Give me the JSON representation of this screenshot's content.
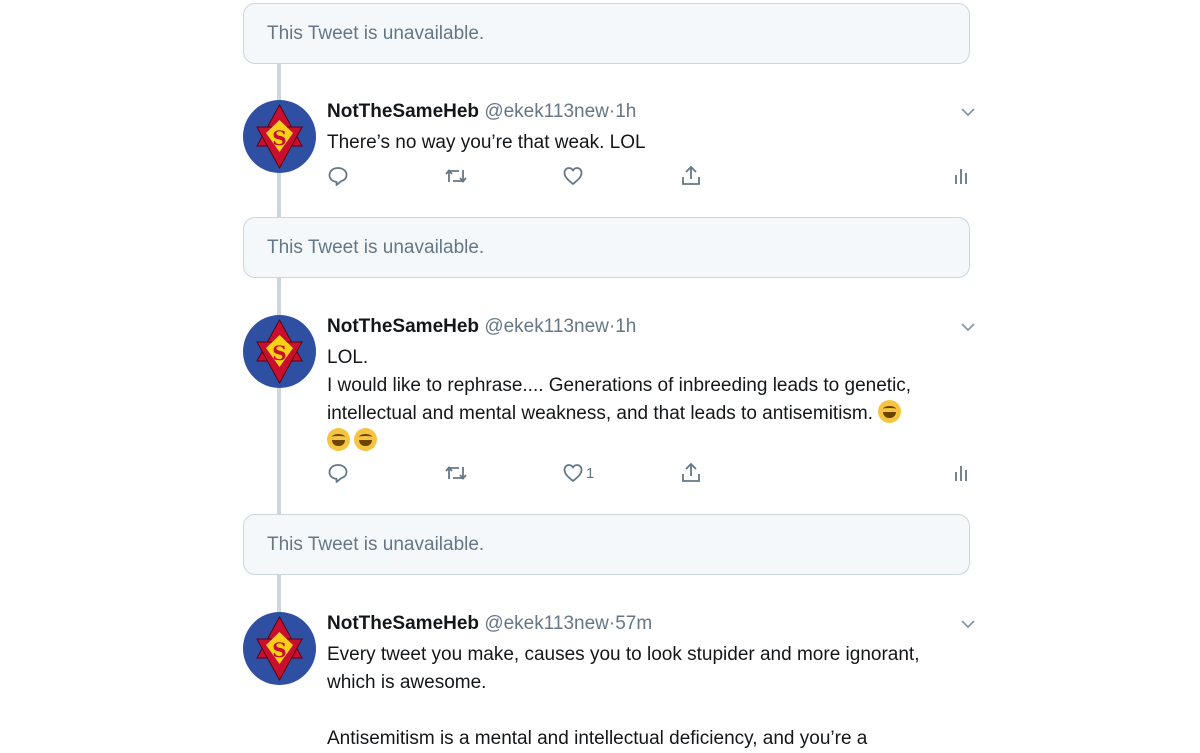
{
  "unavailable_text": "This Tweet is unavailable.",
  "tweets": [
    {
      "name": "NotTheSameHeb",
      "handle": "@ekek113new",
      "separator": "·",
      "time": "1h",
      "text": [
        "There’s no way you’re that weak. LOL"
      ],
      "likes": ""
    },
    {
      "name": "NotTheSameHeb",
      "handle": "@ekek113new",
      "separator": "·",
      "time": "1h",
      "text": [
        "LOL.",
        "I would like to rephrase.... Generations of inbreeding leads to genetic,",
        "intellectual and mental weakness, and that leads to antisemitism."
      ],
      "likes": "1"
    },
    {
      "name": "NotTheSameHeb",
      "handle": "@ekek113new",
      "separator": "·",
      "time": "57m",
      "text": [
        "Every tweet you make, causes you to look stupider and more ignorant,",
        "which is awesome.",
        "",
        "Antisemitism is a mental and intellectual deficiency, and you’re a"
      ],
      "likes": ""
    }
  ],
  "icons": {
    "reply": "reply-icon",
    "retweet": "retweet-icon",
    "like": "like-icon",
    "share": "share-icon",
    "analytics": "analytics-icon",
    "caret": "chevron-down-icon",
    "emoji": "face-with-tears-of-joy-emoji"
  },
  "colors": {
    "secondary_text": "#657786",
    "thread_line": "#ccd6dd",
    "unavailable_bg": "#f5f8fa",
    "avatar_bg": "#2e4fa2",
    "star_red": "#c8102e",
    "emblem_yellow": "#f7d117"
  }
}
